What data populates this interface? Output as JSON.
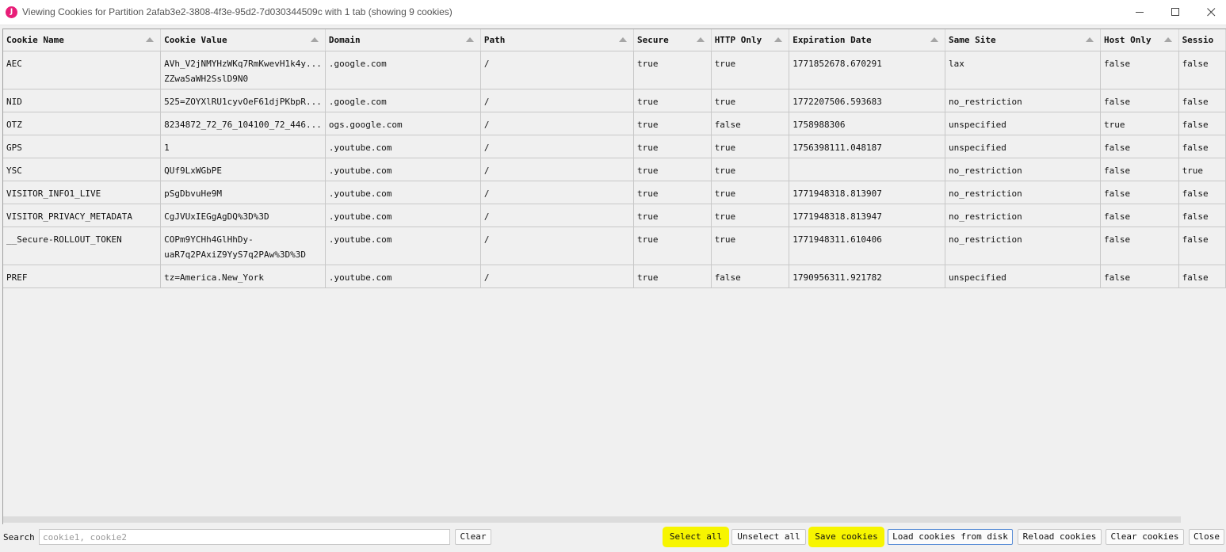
{
  "window": {
    "app_icon_letter": "J",
    "title": "Viewing Cookies for Partition 2afab3e2-3808-4f3e-95d2-7d030344509c with 1 tab (showing 9 cookies)"
  },
  "table": {
    "columns": [
      "Cookie Name",
      "Cookie Value",
      "Domain",
      "Path",
      "Secure",
      "HTTP Only",
      "Expiration Date",
      "Same Site",
      "Host Only",
      "Sessio"
    ],
    "rows": [
      {
        "name": "AEC",
        "value": "AVh_V2jNMYHzWKq7RmKwevH1k4y...",
        "value2": "ZZwaSaWH2SslD9N0",
        "domain": ".google.com",
        "path": "/",
        "secure": "true",
        "http_only": "true",
        "expiration": "1771852678.670291",
        "same_site": "lax",
        "host_only": "false",
        "session": "false"
      },
      {
        "name": "NID",
        "value": "525=ZOYXlRU1cyvOeF61djPKbpR...",
        "value2": "",
        "domain": ".google.com",
        "path": "/",
        "secure": "true",
        "http_only": "true",
        "expiration": "1772207506.593683",
        "same_site": "no_restriction",
        "host_only": "false",
        "session": "false"
      },
      {
        "name": "OTZ",
        "value": "8234872_72_76_104100_72_446...",
        "value2": "",
        "domain": "ogs.google.com",
        "path": "/",
        "secure": "true",
        "http_only": "false",
        "expiration": "1758988306",
        "same_site": "unspecified",
        "host_only": "true",
        "session": "false"
      },
      {
        "name": "GPS",
        "value": "1",
        "value2": "",
        "domain": ".youtube.com",
        "path": "/",
        "secure": "true",
        "http_only": "true",
        "expiration": "1756398111.048187",
        "same_site": "unspecified",
        "host_only": "false",
        "session": "false"
      },
      {
        "name": "YSC",
        "value": "QUf9LxWGbPE",
        "value2": "",
        "domain": ".youtube.com",
        "path": "/",
        "secure": "true",
        "http_only": "true",
        "expiration": "",
        "same_site": "no_restriction",
        "host_only": "false",
        "session": "true"
      },
      {
        "name": "VISITOR_INFO1_LIVE",
        "value": "pSgDbvuHe9M",
        "value2": "",
        "domain": ".youtube.com",
        "path": "/",
        "secure": "true",
        "http_only": "true",
        "expiration": "1771948318.813907",
        "same_site": "no_restriction",
        "host_only": "false",
        "session": "false"
      },
      {
        "name": "VISITOR_PRIVACY_METADATA",
        "value": "CgJVUxIEGgAgDQ%3D%3D",
        "value2": "",
        "domain": ".youtube.com",
        "path": "/",
        "secure": "true",
        "http_only": "true",
        "expiration": "1771948318.813947",
        "same_site": "no_restriction",
        "host_only": "false",
        "session": "false"
      },
      {
        "name": "__Secure-ROLLOUT_TOKEN",
        "value": "COPm9YCHh4GlHhDy-",
        "value2": "uaR7q2PAxiZ9YyS7q2PAw%3D%3D",
        "domain": ".youtube.com",
        "path": "/",
        "secure": "true",
        "http_only": "true",
        "expiration": "1771948311.610406",
        "same_site": "no_restriction",
        "host_only": "false",
        "session": "false"
      },
      {
        "name": "PREF",
        "value": "tz=America.New_York",
        "value2": "",
        "domain": ".youtube.com",
        "path": "/",
        "secure": "true",
        "http_only": "false",
        "expiration": "1790956311.921782",
        "same_site": "unspecified",
        "host_only": "false",
        "session": "false"
      }
    ]
  },
  "bottom": {
    "search_label": "Search",
    "search_placeholder": "cookie1, cookie2",
    "clear_label": "Clear",
    "select_all_label": "Select all",
    "unselect_all_label": "Unselect all",
    "save_cookies_label": "Save cookies",
    "load_cookies_label": "Load cookies from disk",
    "reload_cookies_label": "Reload cookies",
    "clear_cookies_label": "Clear cookies",
    "close_label": "Close",
    "highlight_color": "#f7f500"
  }
}
